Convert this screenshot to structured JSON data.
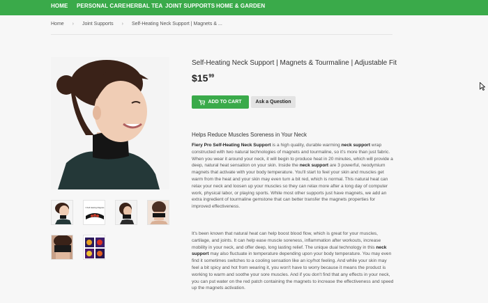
{
  "nav": {
    "items": [
      "HOME",
      "PERSONAL CARE",
      "HERBAL TEA",
      "JOINT SUPPORTS",
      "HOME & GARDEN"
    ]
  },
  "breadcrumb": {
    "items": [
      "Home",
      "Joint Supports",
      "Self-Heating Neck Support | Magnets & ..."
    ]
  },
  "product": {
    "title": "Self-Heating Neck Support | Magnets & Tourmaline | Adjustable Fit",
    "price_main": "$15",
    "price_cents": "99",
    "add_to_cart": "ADD TO CART",
    "ask_question": "Ask a Question",
    "thumb2_caption": "3 Self Heating Magnets",
    "accent_color": "#3aaa4a"
  },
  "description": {
    "heading": "Helps Reduce Muscles Soreness in Your Neck",
    "p1_bold1": "Fiery Pro Self-Heating Neck Support",
    "p1_text1": " is a high quality, durable warming ",
    "p1_bold2": "neck support",
    "p1_text2": " wrap constructed with two natural technologies of magnets and tourmaline, so it's more than just fabric. When you wear it around your neck, it will begin to produce heat in 20 minutes, which will provide a deep, natural heat sensation on your skin. Inside the ",
    "p1_bold3": "neck support",
    "p1_text3": " are 3 powerful, neodymium magnets that activate with your body temperature. You'll start to feel your skin and muscles get warm from the heat and your skin may even turn a bit red, which is normal. This natural heat can relax your neck and loosen up your muscles so they can relax more after a long day of computer work, physical labor, or playing sports. While most other supports just have magnets, we add an extra ingredient of tourmaline gemstone that can better transfer the magnets properties for improved effectiveness.",
    "p2_text1": "It's been known that natural heat can help boost blood flow, which is great for your muscles, cartilage, and joints. It can help ease muscle soreness, inflammation after workouts, increase mobility in your neck, and offer deep, long lasting relief. The unique dual technology in this ",
    "p2_bold1": "neck support",
    "p2_text2": " may also fluctuate in temperature depending upon your body temperature. You may even find it sometimes switches to a cooling sensation like an icy/hot feeling. And while your skin may feel a bit spicy and hot from wearing it, you won't have to worry because it means the product is working to warm and soothe your sore muscles. And if you don't find that any effects in your neck, you can put water on the red patch containing the magnets to increase the effectiveness and speed up the magnets activation."
  }
}
